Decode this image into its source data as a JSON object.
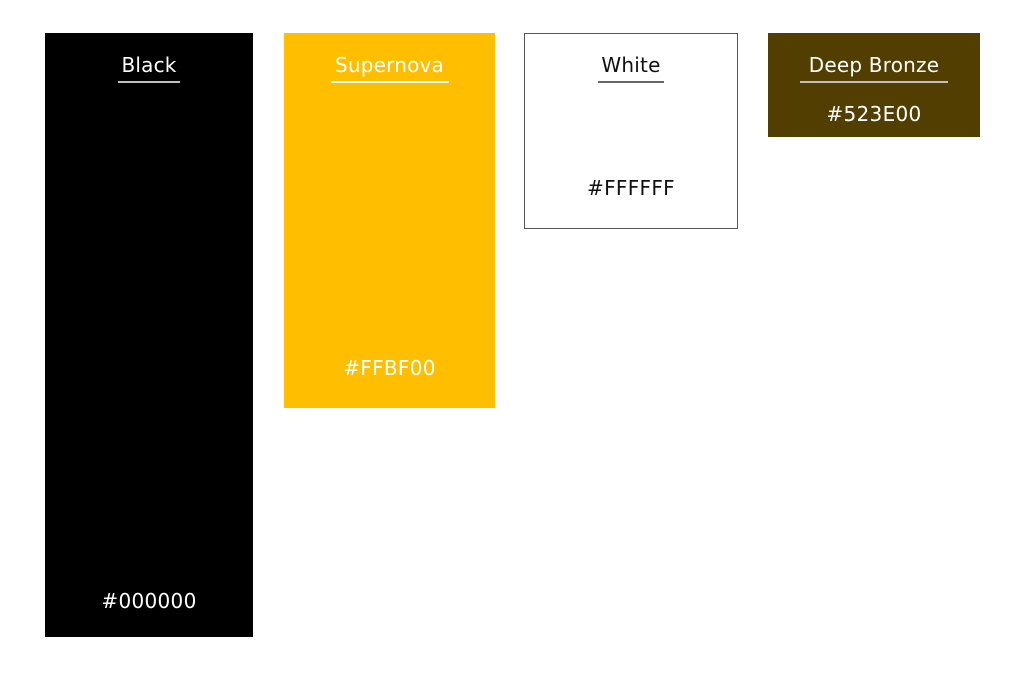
{
  "palette": {
    "swatches": [
      {
        "name": "Black",
        "hex": "#000000",
        "background": "#000000",
        "text_color": "#ffffff",
        "underline_color": "#bfbfbf"
      },
      {
        "name": "Supernova",
        "hex": "#FFBF00",
        "background": "#ffbf00",
        "text_color": "#ffffff",
        "underline_color": "#ffffff"
      },
      {
        "name": "White",
        "hex": "#FFFFFF",
        "background": "#ffffff",
        "text_color": "#111111",
        "underline_color": "#666666"
      },
      {
        "name": "Deep Bronze",
        "hex": "#523E00",
        "background": "#523e00",
        "text_color": "#ffffff",
        "underline_color": "#bfbfbf"
      }
    ]
  }
}
